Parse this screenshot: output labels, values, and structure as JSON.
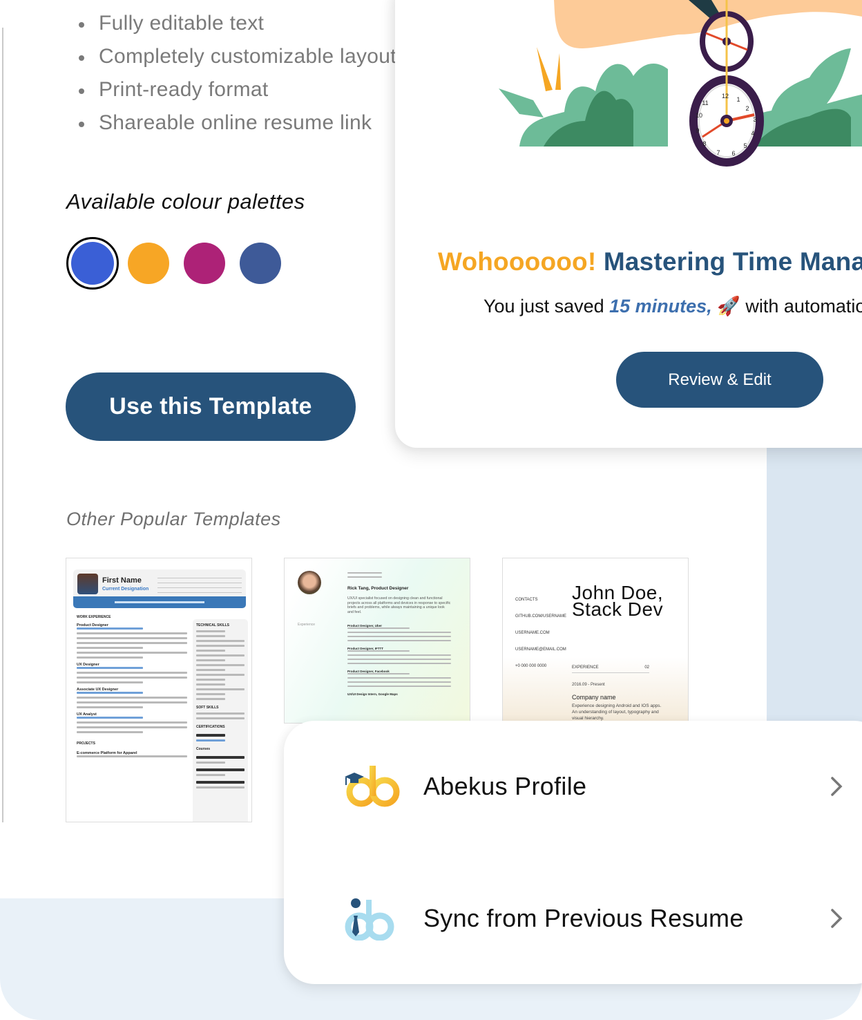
{
  "features": [
    "Fully editable text",
    "Completely customizable layout",
    "Print-ready format",
    "Shareable online resume link"
  ],
  "palettes": {
    "title": "Available colour palettes",
    "colors": [
      "#3a5fd6",
      "#f7a625",
      "#ad2277",
      "#3e5a98"
    ],
    "selected_index": 0
  },
  "use_template_label": "Use this Template",
  "other_templates": {
    "title": "Other Popular Templates",
    "items": [
      {
        "name": "First Name",
        "designation": "Current Designation",
        "section": "WORK EXPERIENCE",
        "roles": [
          "Product Designer",
          "UX Designer",
          "Associate UX Designer",
          "UX Analyst"
        ],
        "side_sections": [
          "TECHNICAL SKILLS",
          "SOFT SKILLS",
          "CERTIFICATIONS",
          "Courses"
        ],
        "projects_title": "PROJECTS",
        "project": "E-commerce Platform for Apparel"
      },
      {
        "name": "Rick Tang, Product Designer",
        "summary": "UX/UI specialist focused on designing clean and functional projects across all platforms and devices in response to specific briefs and problems, while always maintaining a unique look and feel.",
        "section": "Experience",
        "roles": [
          "Product Designer, Uber",
          "Product Designer, IFTTT",
          "Product Designer, Facebook",
          "UX/UI Design Intern, Google Maps"
        ]
      },
      {
        "name_line1": "John Doe,",
        "name_line2": "Stack Dev",
        "contacts_title": "CONTACTS",
        "contacts": [
          "GITHUB.COM/USERNAME",
          "USERNAME.COM",
          "USERNAME@EMAIL.COM",
          "+0 000 000 0000"
        ],
        "experience_title": "EXPERIENCE",
        "experience_num": "02",
        "period": "2016.09 - Present",
        "company": "Company name",
        "description": "Experience designing Android and IOS apps. An understanding of layout, typography and visual hierarchy."
      }
    ]
  },
  "modal": {
    "title_highlight": "Wohoooooo!",
    "title_main": "Mastering Time Management",
    "subtitle_prefix": "You just saved ",
    "time_saved": "15 minutes,",
    "emoji": "🚀",
    "subtitle_suffix": " with automation",
    "review_button": "Review & Edit",
    "illustration": "clock-unicycle-illustration"
  },
  "options": [
    {
      "label": "Abekus Profile",
      "icon": "abekus-logo-graduation-cap"
    },
    {
      "label": "Sync from Previous Resume",
      "icon": "abekus-logo-tie"
    }
  ]
}
